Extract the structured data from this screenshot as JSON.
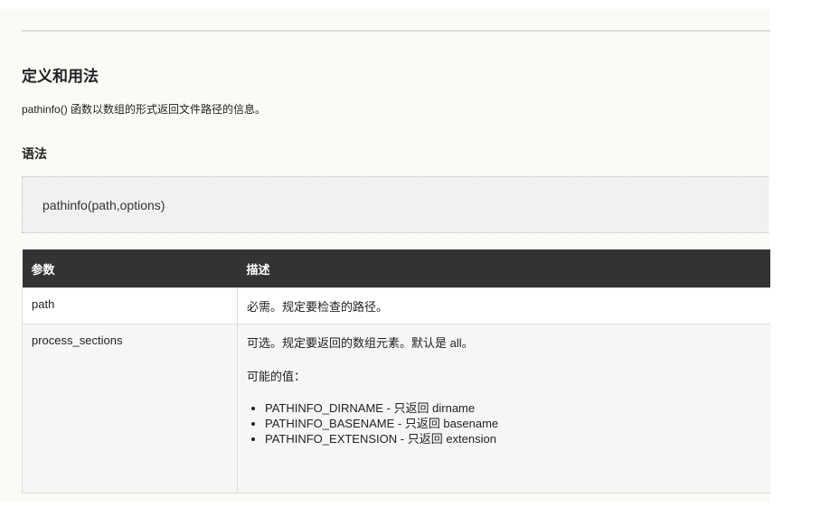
{
  "section_title": "定义和用法",
  "description": "pathinfo() 函数以数组的形式返回文件路径的信息。",
  "syntax_title": "语法",
  "syntax_code": "pathinfo(path,options)",
  "table": {
    "headers": [
      "参数",
      "描述"
    ],
    "rows": [
      {
        "param": "path",
        "desc": "必需。规定要检查的路径。"
      },
      {
        "param": "process_sections",
        "desc": "可选。规定要返回的数组元素。默认是 all。",
        "possible": "可能的值：",
        "values": [
          "PATHINFO_DIRNAME - 只返回 dirname",
          "PATHINFO_BASENAME - 只返回 basename",
          "PATHINFO_EXTENSION - 只返回 extension"
        ]
      }
    ]
  }
}
